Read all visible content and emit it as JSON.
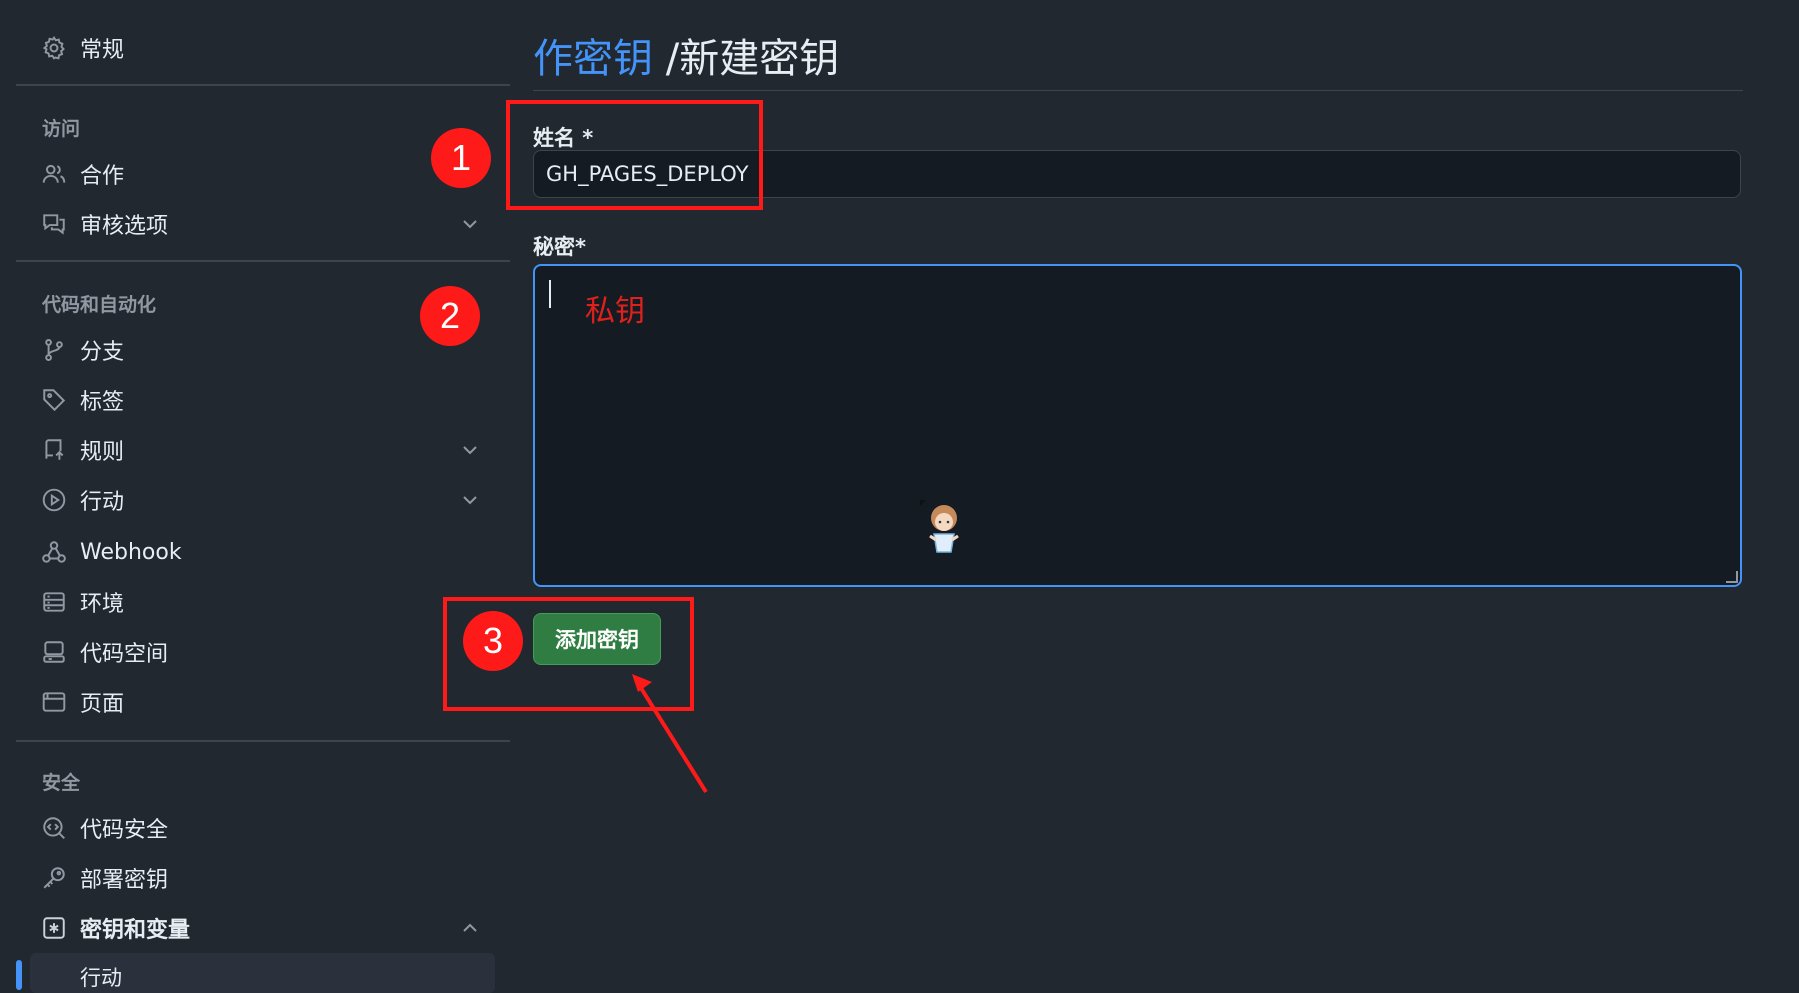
{
  "sidebar": {
    "general": "常规",
    "section_access": "访问",
    "collaborators": "合作",
    "moderation": "审核选项",
    "section_code": "代码和自动化",
    "branches": "分支",
    "tags": "标签",
    "rules": "规则",
    "actions": "行动",
    "webhooks": "Webhook",
    "environments": "环境",
    "codespaces": "代码空间",
    "pages": "页面",
    "section_security": "安全",
    "code_security": "代码安全",
    "deploy_keys": "部署密钥",
    "secrets_and_variables": "密钥和变量",
    "sub_actions": "行动"
  },
  "header": {
    "breadcrumb_link": "作密钥",
    "breadcrumb_current": "/新建密钥"
  },
  "form": {
    "name_label": "姓名 *",
    "name_value": "GH_PAGES_DEPLOY",
    "secret_label": "秘密*",
    "secret_value": "",
    "submit_label": "添加密钥"
  },
  "annotations": {
    "step1": "1",
    "step2": "2",
    "step3": "3",
    "secret_hint": "私钥",
    "color": "#ff1a1a"
  },
  "colors": {
    "background": "#212830",
    "accent_link": "#4493f8",
    "button_green": "#2f7d43"
  }
}
